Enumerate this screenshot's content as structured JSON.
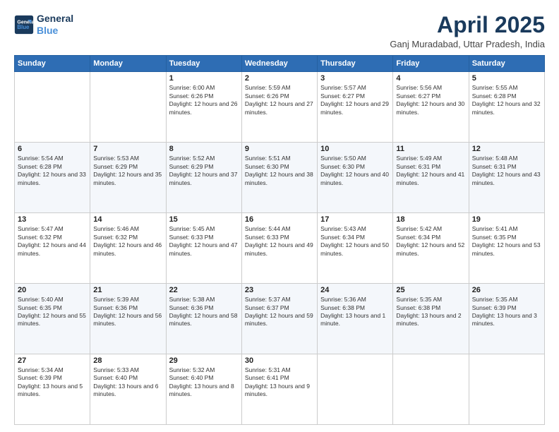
{
  "logo": {
    "line1": "General",
    "line2": "Blue"
  },
  "title": "April 2025",
  "location": "Ganj Muradabad, Uttar Pradesh, India",
  "days_of_week": [
    "Sunday",
    "Monday",
    "Tuesday",
    "Wednesday",
    "Thursday",
    "Friday",
    "Saturday"
  ],
  "weeks": [
    [
      {
        "day": "",
        "sunrise": "",
        "sunset": "",
        "daylight": ""
      },
      {
        "day": "",
        "sunrise": "",
        "sunset": "",
        "daylight": ""
      },
      {
        "day": "1",
        "sunrise": "Sunrise: 6:00 AM",
        "sunset": "Sunset: 6:26 PM",
        "daylight": "Daylight: 12 hours and 26 minutes."
      },
      {
        "day": "2",
        "sunrise": "Sunrise: 5:59 AM",
        "sunset": "Sunset: 6:26 PM",
        "daylight": "Daylight: 12 hours and 27 minutes."
      },
      {
        "day": "3",
        "sunrise": "Sunrise: 5:57 AM",
        "sunset": "Sunset: 6:27 PM",
        "daylight": "Daylight: 12 hours and 29 minutes."
      },
      {
        "day": "4",
        "sunrise": "Sunrise: 5:56 AM",
        "sunset": "Sunset: 6:27 PM",
        "daylight": "Daylight: 12 hours and 30 minutes."
      },
      {
        "day": "5",
        "sunrise": "Sunrise: 5:55 AM",
        "sunset": "Sunset: 6:28 PM",
        "daylight": "Daylight: 12 hours and 32 minutes."
      }
    ],
    [
      {
        "day": "6",
        "sunrise": "Sunrise: 5:54 AM",
        "sunset": "Sunset: 6:28 PM",
        "daylight": "Daylight: 12 hours and 33 minutes."
      },
      {
        "day": "7",
        "sunrise": "Sunrise: 5:53 AM",
        "sunset": "Sunset: 6:29 PM",
        "daylight": "Daylight: 12 hours and 35 minutes."
      },
      {
        "day": "8",
        "sunrise": "Sunrise: 5:52 AM",
        "sunset": "Sunset: 6:29 PM",
        "daylight": "Daylight: 12 hours and 37 minutes."
      },
      {
        "day": "9",
        "sunrise": "Sunrise: 5:51 AM",
        "sunset": "Sunset: 6:30 PM",
        "daylight": "Daylight: 12 hours and 38 minutes."
      },
      {
        "day": "10",
        "sunrise": "Sunrise: 5:50 AM",
        "sunset": "Sunset: 6:30 PM",
        "daylight": "Daylight: 12 hours and 40 minutes."
      },
      {
        "day": "11",
        "sunrise": "Sunrise: 5:49 AM",
        "sunset": "Sunset: 6:31 PM",
        "daylight": "Daylight: 12 hours and 41 minutes."
      },
      {
        "day": "12",
        "sunrise": "Sunrise: 5:48 AM",
        "sunset": "Sunset: 6:31 PM",
        "daylight": "Daylight: 12 hours and 43 minutes."
      }
    ],
    [
      {
        "day": "13",
        "sunrise": "Sunrise: 5:47 AM",
        "sunset": "Sunset: 6:32 PM",
        "daylight": "Daylight: 12 hours and 44 minutes."
      },
      {
        "day": "14",
        "sunrise": "Sunrise: 5:46 AM",
        "sunset": "Sunset: 6:32 PM",
        "daylight": "Daylight: 12 hours and 46 minutes."
      },
      {
        "day": "15",
        "sunrise": "Sunrise: 5:45 AM",
        "sunset": "Sunset: 6:33 PM",
        "daylight": "Daylight: 12 hours and 47 minutes."
      },
      {
        "day": "16",
        "sunrise": "Sunrise: 5:44 AM",
        "sunset": "Sunset: 6:33 PM",
        "daylight": "Daylight: 12 hours and 49 minutes."
      },
      {
        "day": "17",
        "sunrise": "Sunrise: 5:43 AM",
        "sunset": "Sunset: 6:34 PM",
        "daylight": "Daylight: 12 hours and 50 minutes."
      },
      {
        "day": "18",
        "sunrise": "Sunrise: 5:42 AM",
        "sunset": "Sunset: 6:34 PM",
        "daylight": "Daylight: 12 hours and 52 minutes."
      },
      {
        "day": "19",
        "sunrise": "Sunrise: 5:41 AM",
        "sunset": "Sunset: 6:35 PM",
        "daylight": "Daylight: 12 hours and 53 minutes."
      }
    ],
    [
      {
        "day": "20",
        "sunrise": "Sunrise: 5:40 AM",
        "sunset": "Sunset: 6:35 PM",
        "daylight": "Daylight: 12 hours and 55 minutes."
      },
      {
        "day": "21",
        "sunrise": "Sunrise: 5:39 AM",
        "sunset": "Sunset: 6:36 PM",
        "daylight": "Daylight: 12 hours and 56 minutes."
      },
      {
        "day": "22",
        "sunrise": "Sunrise: 5:38 AM",
        "sunset": "Sunset: 6:36 PM",
        "daylight": "Daylight: 12 hours and 58 minutes."
      },
      {
        "day": "23",
        "sunrise": "Sunrise: 5:37 AM",
        "sunset": "Sunset: 6:37 PM",
        "daylight": "Daylight: 12 hours and 59 minutes."
      },
      {
        "day": "24",
        "sunrise": "Sunrise: 5:36 AM",
        "sunset": "Sunset: 6:38 PM",
        "daylight": "Daylight: 13 hours and 1 minute."
      },
      {
        "day": "25",
        "sunrise": "Sunrise: 5:35 AM",
        "sunset": "Sunset: 6:38 PM",
        "daylight": "Daylight: 13 hours and 2 minutes."
      },
      {
        "day": "26",
        "sunrise": "Sunrise: 5:35 AM",
        "sunset": "Sunset: 6:39 PM",
        "daylight": "Daylight: 13 hours and 3 minutes."
      }
    ],
    [
      {
        "day": "27",
        "sunrise": "Sunrise: 5:34 AM",
        "sunset": "Sunset: 6:39 PM",
        "daylight": "Daylight: 13 hours and 5 minutes."
      },
      {
        "day": "28",
        "sunrise": "Sunrise: 5:33 AM",
        "sunset": "Sunset: 6:40 PM",
        "daylight": "Daylight: 13 hours and 6 minutes."
      },
      {
        "day": "29",
        "sunrise": "Sunrise: 5:32 AM",
        "sunset": "Sunset: 6:40 PM",
        "daylight": "Daylight: 13 hours and 8 minutes."
      },
      {
        "day": "30",
        "sunrise": "Sunrise: 5:31 AM",
        "sunset": "Sunset: 6:41 PM",
        "daylight": "Daylight: 13 hours and 9 minutes."
      },
      {
        "day": "",
        "sunrise": "",
        "sunset": "",
        "daylight": ""
      },
      {
        "day": "",
        "sunrise": "",
        "sunset": "",
        "daylight": ""
      },
      {
        "day": "",
        "sunrise": "",
        "sunset": "",
        "daylight": ""
      }
    ]
  ]
}
